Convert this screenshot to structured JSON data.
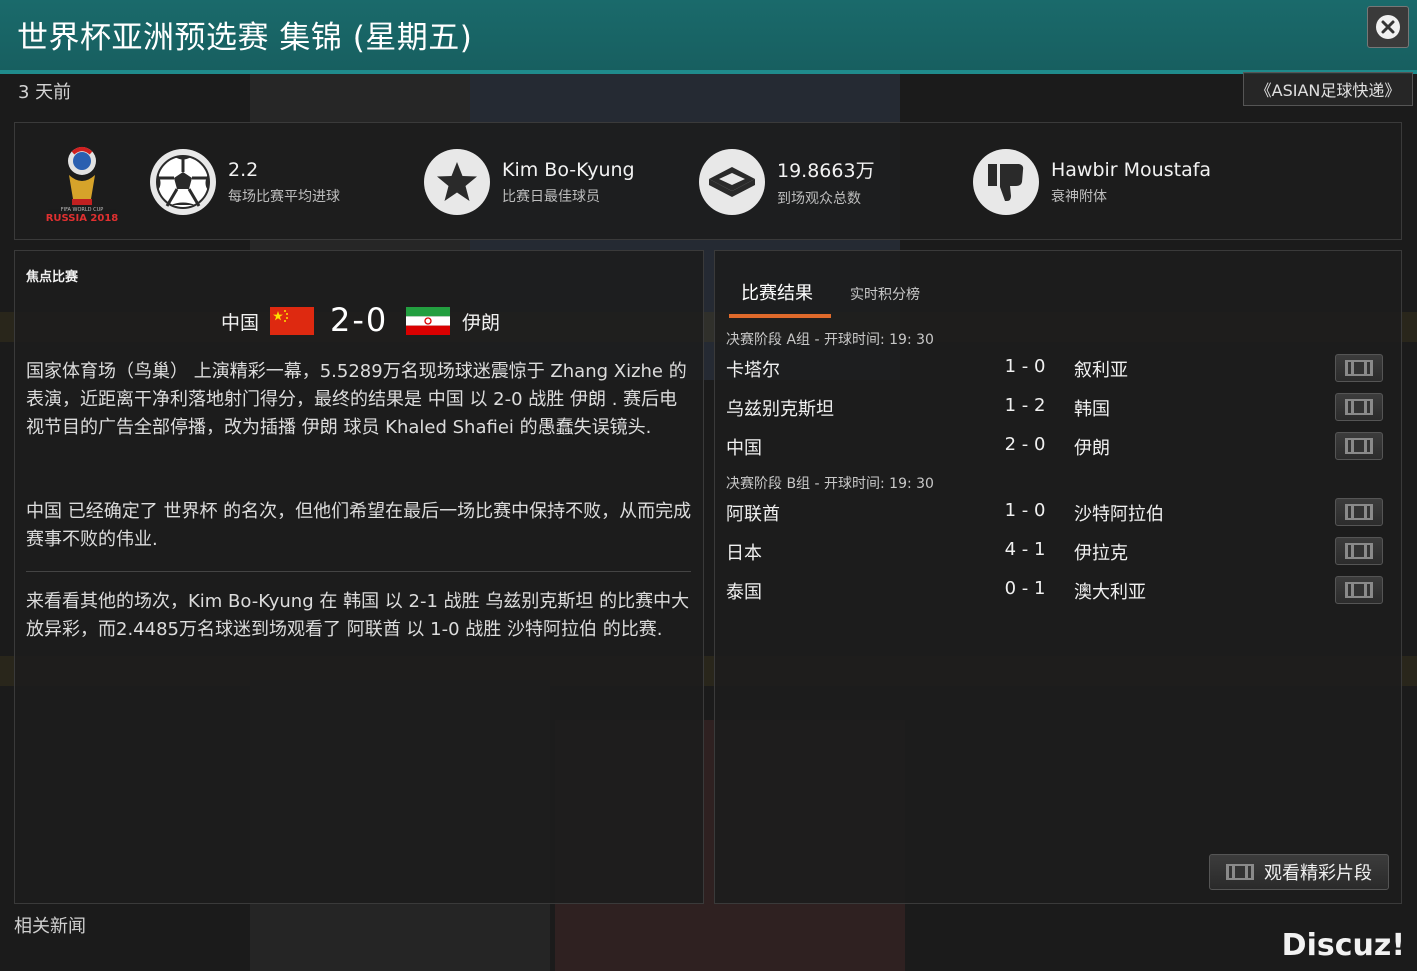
{
  "window": {
    "title": "世界杯亚洲预选赛 集锦 (星期五)",
    "close": "close"
  },
  "meta": {
    "time_ago": "3 天前",
    "source_label": "《ASIAN足球快递》"
  },
  "stats": [
    {
      "icon": "soccer-ball-icon",
      "value": "2.2",
      "label": "每场比赛平均进球"
    },
    {
      "icon": "star-icon",
      "value": "Kim Bo-Kyung",
      "label": "比赛日最佳球员"
    },
    {
      "icon": "stadium-icon",
      "value": "19.8663万",
      "label": "到场观众总数"
    },
    {
      "icon": "thumbs-down-icon",
      "value": "Hawbir Moustafa",
      "label": "衰神附体"
    }
  ],
  "logo": {
    "text": "RUSSIA 2018",
    "subtext": "FIFA WORLD CUP"
  },
  "featured": {
    "section_label": "焦点比赛",
    "home": "中国",
    "away": "伊朗",
    "score": "2-0"
  },
  "article": {
    "p1": "国家体育场（鸟巢） 上演精彩一幕，5.5289万名现场球迷震惊于 Zhang Xizhe 的表演，近距离干净利落地射门得分，最终的结果是 中国 以 2-0 战胜 伊朗 . 赛后电视节目的广告全部停播，改为插播 伊朗 球员 Khaled Shafiei 的愚蠢失误镜头.",
    "p2": "中国 已经确定了 世界杯 的名次，但他们希望在最后一场比赛中保持不败，从而完成赛事不败的伟业.",
    "p3": "来看看其他的场次，Kim Bo-Kyung 在 韩国 以 2-1 战胜 乌兹别克斯坦 的比赛中大放异彩，而2.4485万名球迷到场观看了 阿联酋 以 1-0 战胜 沙特阿拉伯 的比赛."
  },
  "results": {
    "tabs": [
      "比赛结果",
      "实时积分榜"
    ],
    "groups": [
      {
        "header": "决赛阶段 A组 - 开球时间: 19: 30",
        "matches": [
          {
            "home": "卡塔尔",
            "score": "1 - 0",
            "away": "叙利亚"
          },
          {
            "home": "乌兹别克斯坦",
            "score": "1 - 2",
            "away": "韩国"
          },
          {
            "home": "中国",
            "score": "2 - 0",
            "away": "伊朗"
          }
        ]
      },
      {
        "header": "决赛阶段 B组 - 开球时间: 19: 30",
        "matches": [
          {
            "home": "阿联酋",
            "score": "1 - 0",
            "away": "沙特阿拉伯"
          },
          {
            "home": "日本",
            "score": "4 - 1",
            "away": "伊拉克"
          },
          {
            "home": "泰国",
            "score": "0 - 1",
            "away": "澳大利亚"
          }
        ]
      }
    ],
    "highlights_label": "观看精彩片段"
  },
  "footer": {
    "related_news": "相关新闻",
    "watermark": "Discuz!"
  },
  "colors": {
    "title_bar": "#1a6a6b",
    "accent": "#e06a2b",
    "china_red": "#de2910",
    "iran_green": "#239f40",
    "iran_red": "#da0000"
  }
}
